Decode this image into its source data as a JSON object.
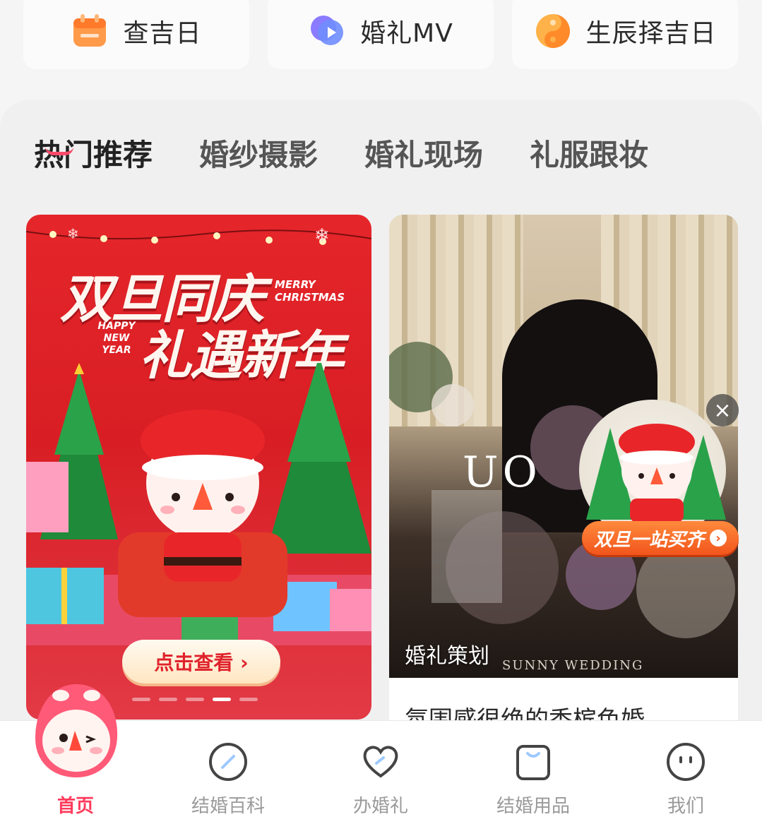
{
  "tools": [
    {
      "label": "查吉日",
      "icon": "calendar-icon"
    },
    {
      "label": "婚礼MV",
      "icon": "video-play-icon"
    },
    {
      "label": "生辰择吉日",
      "icon": "yin-yang-icon"
    }
  ],
  "tabs": [
    {
      "label": "热门推荐",
      "active": true
    },
    {
      "label": "婚纱摄影",
      "active": false
    },
    {
      "label": "婚礼现场",
      "active": false
    },
    {
      "label": "礼服跟妆",
      "active": false
    }
  ],
  "banner": {
    "line1": "双旦同庆",
    "line2": "礼遇新年",
    "merry": "MERRY CHRISTMAS",
    "happy": "HAPPY NEW YEAR",
    "button": "点击查看 ›",
    "dots_total": 5,
    "dots_active_index": 3
  },
  "article": {
    "photo_label": "婚礼策划",
    "photo_sign": "UO",
    "photo_watermark": "SUNNY WEDDING",
    "title": "氛围感很绝的香槟色婚"
  },
  "float_ad": {
    "button": "双旦一站买齐",
    "close": "×"
  },
  "nav": [
    {
      "label": "首页",
      "icon": "mascot-icon",
      "active": true
    },
    {
      "label": "结婚百科",
      "icon": "compass-icon",
      "active": false
    },
    {
      "label": "办婚礼",
      "icon": "heart-icon",
      "active": false
    },
    {
      "label": "结婚用品",
      "icon": "bag-icon",
      "active": false
    },
    {
      "label": "我们",
      "icon": "smiley-icon",
      "active": false
    }
  ],
  "colors": {
    "accent": "#ff3b5c",
    "banner_red": "#e0222b",
    "float_orange": "#f2551c"
  }
}
